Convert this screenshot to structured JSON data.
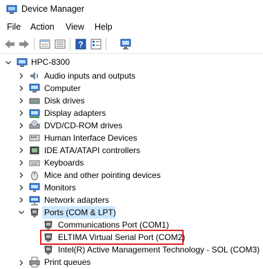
{
  "window": {
    "title": "Device Manager"
  },
  "menu": [
    "File",
    "Action",
    "View",
    "Help"
  ],
  "toolbar": {
    "buttons": [
      "back-arrow-icon",
      "forward-arrow-icon",
      "properties-grid-icon",
      "device-list-icon",
      "help-icon",
      "details-icon",
      "monitor-scan-icon"
    ]
  },
  "tree": {
    "root": "HPC-8300",
    "categories": [
      {
        "label": "Audio inputs and outputs",
        "icon": "speaker-icon"
      },
      {
        "label": "Computer",
        "icon": "computer-icon"
      },
      {
        "label": "Disk drives",
        "icon": "disk-drive-icon"
      },
      {
        "label": "Display adapters",
        "icon": "display-adapter-icon"
      },
      {
        "label": "DVD/CD-ROM drives",
        "icon": "dvd-drive-icon"
      },
      {
        "label": "Human Interface Devices",
        "icon": "hid-icon"
      },
      {
        "label": "IDE ATA/ATAPI controllers",
        "icon": "ide-controller-icon"
      },
      {
        "label": "Keyboards",
        "icon": "keyboard-icon"
      },
      {
        "label": "Mice and other pointing devices",
        "icon": "mouse-icon"
      },
      {
        "label": "Monitors",
        "icon": "monitor-icon"
      },
      {
        "label": "Network adapters",
        "icon": "network-adapter-icon"
      },
      {
        "label": "Ports (COM & LPT)",
        "icon": "port-icon",
        "expanded": true,
        "selected": true
      },
      {
        "label": "Print queues",
        "icon": "printer-icon"
      }
    ],
    "ports": [
      {
        "label": "Communications Port (COM1)"
      },
      {
        "label": "ELTIMA Virtual Serial Port (COM2)",
        "highlighted": true
      },
      {
        "label": "Intel(R) Active Management Technology - SOL (COM3)"
      }
    ]
  },
  "colors": {
    "selection": "#cce8ff",
    "highlight_border": "#e02020",
    "icon_blue": "#2b6cc4"
  }
}
